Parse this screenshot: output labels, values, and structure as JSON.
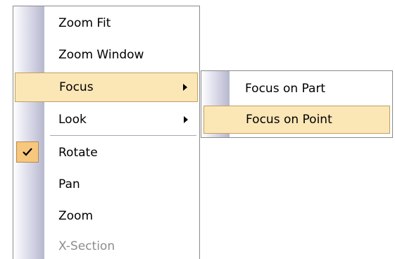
{
  "context_menu": {
    "items": [
      {
        "label": "Zoom Fit"
      },
      {
        "label": "Zoom Window"
      },
      {
        "label": "Focus",
        "has_submenu": true,
        "highlighted": true
      },
      {
        "label": "Look",
        "has_submenu": true
      },
      {
        "label": "Rotate",
        "checked": true
      },
      {
        "label": "Pan"
      },
      {
        "label": "Zoom"
      },
      {
        "label": "X-Section",
        "disabled": true
      }
    ]
  },
  "focus_submenu": {
    "items": [
      {
        "label": "Focus on Part"
      },
      {
        "label": "Focus on Point",
        "highlighted": true
      }
    ]
  },
  "colors": {
    "highlight_fill": "#fbe6b6",
    "highlight_border": "#c0a063",
    "check_fill": "#f7c77d",
    "gutter": "#c9c9dc",
    "disabled_text": "#8d8d8d"
  },
  "icons": {
    "submenu_arrow": "chevron-right-icon",
    "checked": "checkmark-icon"
  }
}
